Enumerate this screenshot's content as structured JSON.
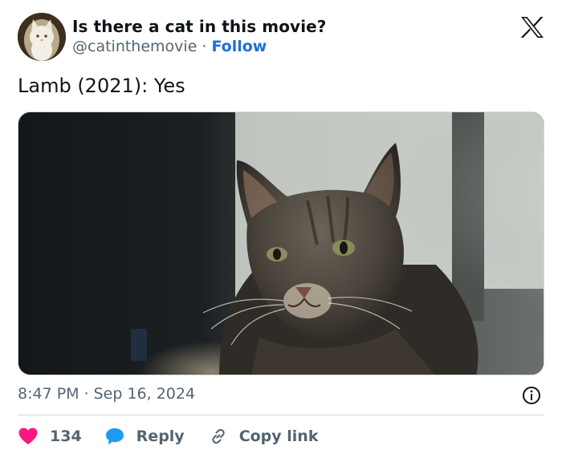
{
  "author": {
    "display_name": "Is there a cat in this movie?",
    "handle": "@catinthemovie",
    "separator": "·",
    "follow_label": "Follow",
    "avatar_icon": "white-cat-avatar"
  },
  "brand": {
    "logo_icon": "x-logo-icon"
  },
  "tweet": {
    "text": "Lamb (2021): Yes",
    "media_icon": "tabby-cat-movie-still"
  },
  "meta": {
    "time": "8:47 PM",
    "separator": "·",
    "date": "Sep 16, 2024",
    "info_icon": "info-icon"
  },
  "actions": {
    "like_count": "134",
    "like_icon": "heart-icon",
    "like_color": "#f91880",
    "reply_label": "Reply",
    "reply_icon": "speech-bubble-icon",
    "reply_color": "#1d9bf0",
    "copy_label": "Copy link",
    "copy_icon": "link-icon"
  },
  "colors": {
    "text": "#0f1419",
    "secondary": "#536471",
    "follow": "#1d70d6",
    "border": "#cfd9de"
  }
}
